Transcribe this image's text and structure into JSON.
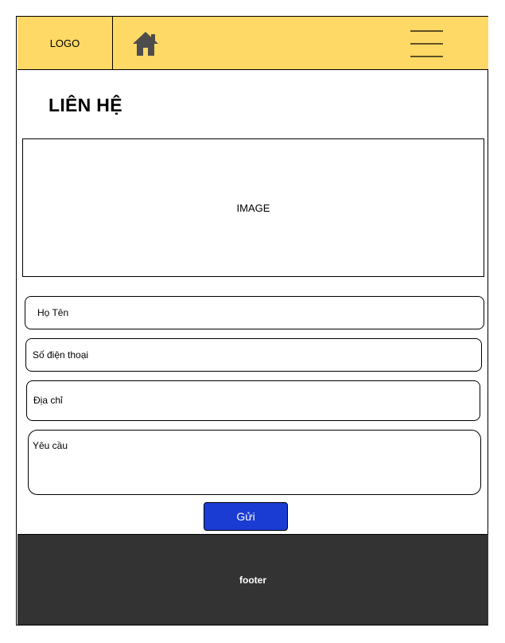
{
  "header": {
    "logo": "LOGO",
    "home_icon": "home-icon",
    "menu_icon": "hamburger-menu-icon",
    "background": "#ffd966"
  },
  "main": {
    "title": "LIÊN HỆ",
    "image_placeholder": "IMAGE",
    "form": {
      "name_placeholder": "Họ Tên",
      "phone_placeholder": "Số điện thoại",
      "address_placeholder": "Địa chỉ",
      "request_placeholder": "Yêu cầu",
      "submit_label": "Gửi",
      "submit_color": "#1b3cd2"
    }
  },
  "footer": {
    "label": "footer",
    "background": "#333333"
  }
}
